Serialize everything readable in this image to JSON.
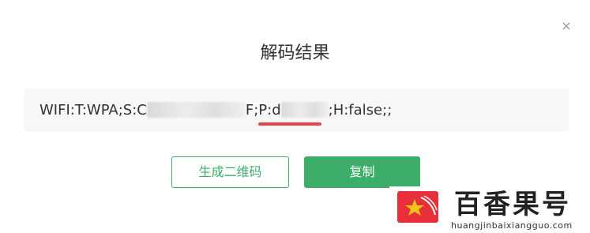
{
  "dialog": {
    "title": "解码结果",
    "close_icon": "close-icon",
    "close_glyph": "×"
  },
  "result": {
    "prefix": "WIFI:T:WPA;S:C",
    "ssid_tail": "F",
    "password_prefix": ";P:d",
    "suffix": ";H:false;;"
  },
  "buttons": {
    "generate_qr_label": "生成二维码",
    "copy_label": "复制"
  },
  "watermark": {
    "brand": "百香果号",
    "url": "huangjinbaixiangguo.com"
  },
  "colors": {
    "accent_green": "#3cae6a",
    "underline_red": "#e8434d",
    "result_bg": "#f7f9f6"
  }
}
